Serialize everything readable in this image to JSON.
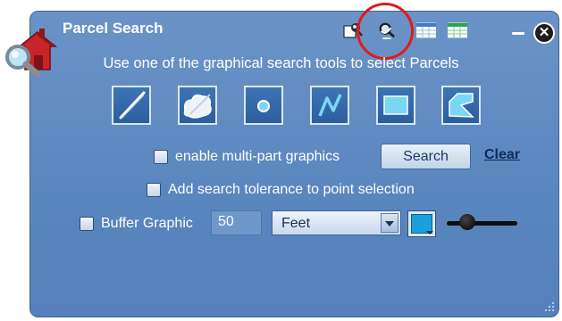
{
  "window": {
    "title": "Parcel Search"
  },
  "toolbar_icons": [
    "search-by-shape-icon",
    "graphical-search-icon",
    "attribute-search-icon",
    "results-table-icon"
  ],
  "instructions": "Use one of the graphical search tools to select Parcels",
  "tools": [
    "freehand-line-tool",
    "freehand-polygon-tool",
    "point-tool",
    "polyline-tool",
    "rectangle-tool",
    "polygon-tool"
  ],
  "multipart": {
    "label": "enable multi-part graphics",
    "checked": false
  },
  "buttons": {
    "search": "Search",
    "clear": "Clear"
  },
  "tolerance": {
    "label": "Add search tolerance to point selection",
    "checked": false
  },
  "buffer": {
    "label": "Buffer Graphic",
    "checked": false,
    "distance": "50",
    "unit": "Feet",
    "fill_color": "#1aa0e0"
  },
  "highlight_color": "#e01b1b"
}
